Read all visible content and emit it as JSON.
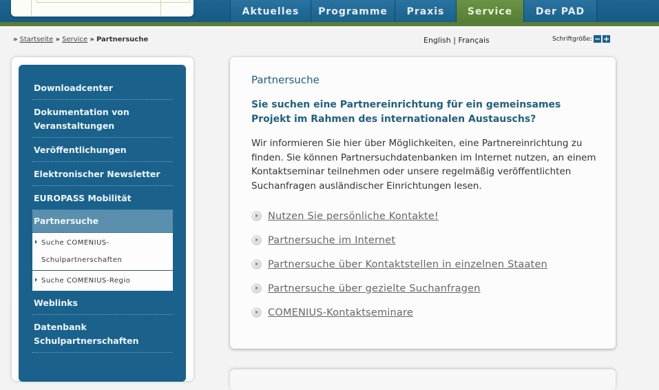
{
  "nav": {
    "items": [
      {
        "label": "Aktuelles",
        "active": false
      },
      {
        "label": "Programme",
        "active": false
      },
      {
        "label": "Praxis",
        "active": false
      },
      {
        "label": "Service",
        "active": true
      },
      {
        "label": "Der PAD",
        "active": false
      }
    ]
  },
  "breadcrumb": {
    "separator": "»",
    "items": [
      "Startseite",
      "Service"
    ],
    "current": "Partnersuche"
  },
  "languages": {
    "english": "English",
    "divider": "|",
    "french": "Français"
  },
  "font_size": {
    "label": "Schriftgröße:",
    "decrease": "−",
    "increase": "+"
  },
  "sidebar": {
    "items": [
      {
        "label": "Downloadcenter"
      },
      {
        "label": "Dokumentation von Veranstaltungen"
      },
      {
        "label": "Veröffentlichungen"
      },
      {
        "label": "Elektronischer Newsletter"
      },
      {
        "label": "EUROPASS Mobilität"
      },
      {
        "label": "Partnersuche",
        "active": true
      },
      {
        "label": "Weblinks"
      },
      {
        "label": "Datenbank Schulpartnerschaften"
      }
    ],
    "subitems": [
      {
        "label": "Suche COMENIUS-Schulpartnerschaften"
      },
      {
        "label": "Suche COMENIUS-Regio"
      }
    ]
  },
  "main": {
    "title": "Partnersuche",
    "lead": "Sie suchen eine Partnereinrichtung für ein gemeinsames Projekt im Rahmen des internationalen Austauschs?",
    "intro": "Wir informieren Sie hier über Möglichkeiten, eine Partnereinrichtung zu finden. Sie können Partnersuchdatenbanken im Internet nutzen, an einem Kontaktseminar teilnehmen oder unsere regelmäßig veröffentlichten Suchanfragen ausländischer Einrichtungen lesen.",
    "links": [
      {
        "label": "Nutzen Sie persönliche Kontakte!"
      },
      {
        "label": "Partnersuche im Internet"
      },
      {
        "label": "Partnersuche über Kontaktstellen in einzelnen Staaten"
      },
      {
        "label": "Partnersuche über gezielte Suchanfragen"
      },
      {
        "label": "COMENIUS-Kontaktseminare"
      }
    ]
  },
  "colors": {
    "nav_blue": "#1d6592",
    "nav_active_green": "#5a7d3a",
    "sidebar_blue": "#1a628c",
    "sidebar_active": "#5a8fae",
    "heading_teal": "#205f80"
  }
}
